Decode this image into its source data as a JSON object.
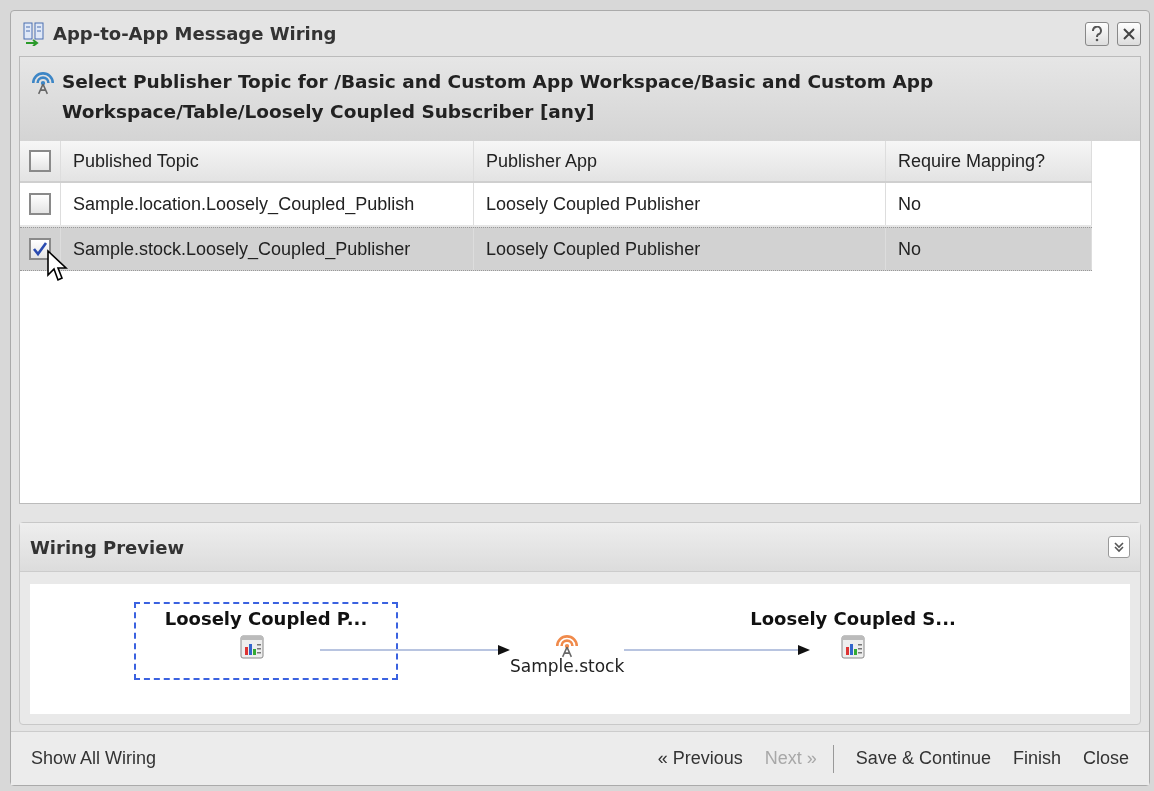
{
  "window": {
    "title": "App-to-App Message Wiring"
  },
  "header": {
    "text": "Select Publisher Topic for /Basic and Custom App Workspace/Basic and Custom App Workspace/Table/Loosely Coupled Subscriber [any]"
  },
  "table": {
    "select_all": {
      "checked": false
    },
    "columns": [
      "Published Topic",
      "Publisher App",
      "Require Mapping?"
    ],
    "rows": [
      {
        "checked": false,
        "selected": false,
        "cells": [
          "Sample.location.Loosely_Coupled_Publish",
          "Loosely Coupled Publisher",
          "No"
        ]
      },
      {
        "checked": true,
        "selected": true,
        "cells": [
          "Sample.stock.Loosely_Coupled_Publisher",
          "Loosely Coupled Publisher",
          "No"
        ]
      }
    ]
  },
  "preview": {
    "title": "Wiring Preview",
    "publisher": {
      "label": "Loosely Coupled P...",
      "selected": true
    },
    "topic": {
      "label": "Sample.stock"
    },
    "subscriber": {
      "label": "Loosely Coupled S..."
    }
  },
  "footer": {
    "link": "Show All Wiring",
    "buttons": [
      {
        "label": "« Previous",
        "disabled": false
      },
      {
        "label": "Next »",
        "disabled": true
      },
      {
        "label": "Save & Continue",
        "disabled": false
      },
      {
        "label": "Finish",
        "disabled": false
      },
      {
        "label": "Close",
        "disabled": false
      }
    ]
  }
}
